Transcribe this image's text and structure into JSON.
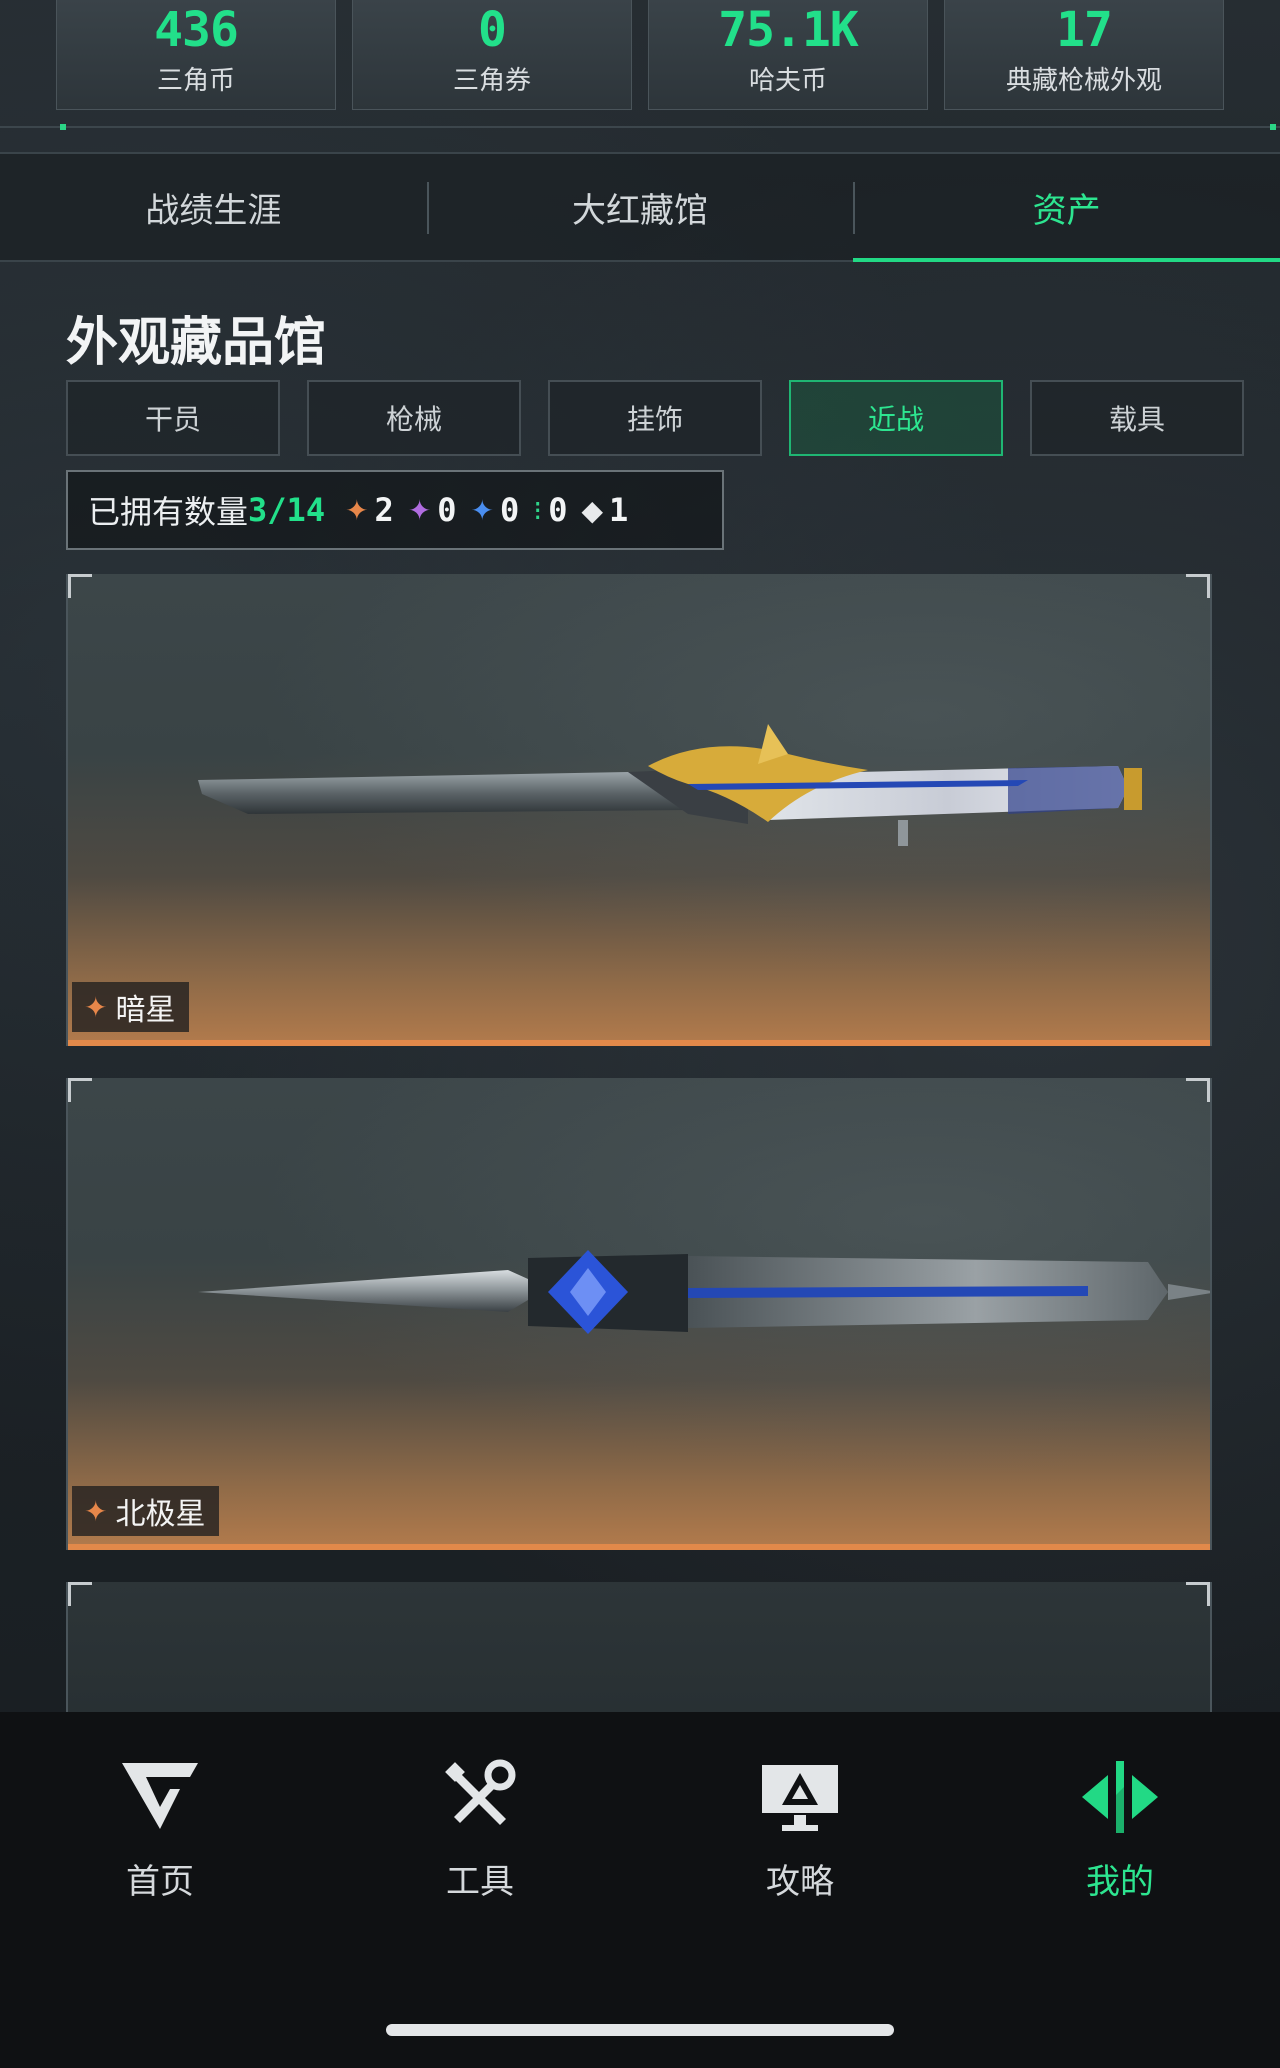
{
  "stats": [
    {
      "value": "436",
      "label": "三角币"
    },
    {
      "value": "0",
      "label": "三角券"
    },
    {
      "value": "75.1K",
      "label": "哈夫币"
    },
    {
      "value": "17",
      "label": "典藏枪械外观"
    }
  ],
  "tabs": [
    {
      "label": "战绩生涯"
    },
    {
      "label": "大红藏馆"
    },
    {
      "label": "资产"
    }
  ],
  "section": {
    "title": "外观藏品馆"
  },
  "categories": [
    {
      "label": "干员"
    },
    {
      "label": "枪械"
    },
    {
      "label": "挂饰"
    },
    {
      "label": "近战"
    },
    {
      "label": "载具"
    }
  ],
  "owned": {
    "label": "已拥有数量",
    "count": "3/14",
    "rarities": [
      {
        "color": "#e7874a",
        "count": "2"
      },
      {
        "color": "#b06ce0",
        "count": "0"
      },
      {
        "color": "#4a8ef0",
        "count": "0"
      },
      {
        "color": "#2fd48a",
        "count": "0"
      },
      {
        "color": "#e8eaec",
        "count": "1"
      }
    ]
  },
  "items": [
    {
      "name": "暗星",
      "rarity_color": "#e7874a"
    },
    {
      "name": "北极星",
      "rarity_color": "#e7874a"
    }
  ],
  "nav": [
    {
      "label": "首页",
      "icon": "home-g-icon"
    },
    {
      "label": "工具",
      "icon": "tools-icon"
    },
    {
      "label": "攻略",
      "icon": "guide-monitor-icon"
    },
    {
      "label": "我的",
      "icon": "profile-diamond-icon"
    }
  ]
}
